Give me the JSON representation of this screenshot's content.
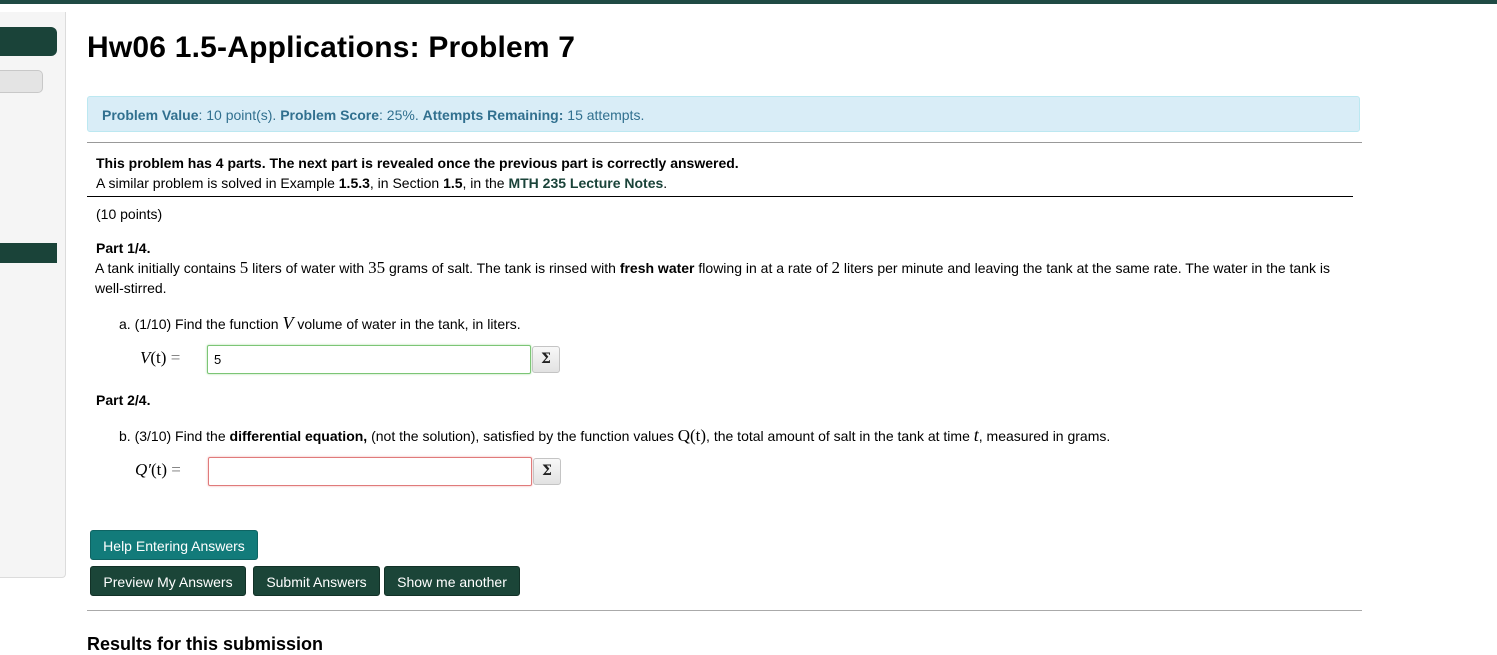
{
  "page_title": "Hw06 1.5-Applications: Problem 7",
  "info": {
    "value_label": "Problem Value",
    "value_text": ": 10 point(s). ",
    "score_label": "Problem Score",
    "score_text": ": 25%. ",
    "attempts_label": "Attempts Remaining:",
    "attempts_text": " 15 attempts."
  },
  "intro": {
    "line1": "This problem has 4 parts. The next part is revealed once the previous part is correctly answered.",
    "line2_a": "A similar problem is solved in Example ",
    "line2_example": "1.5.3",
    "line2_b": ", in Section ",
    "line2_section": "1.5",
    "line2_c": ", in the ",
    "line2_link": "MTH 235 Lecture Notes",
    "line2_d": "."
  },
  "points": "(10 points)",
  "part1": {
    "heading": "Part 1/4.",
    "t1": "A tank initially contains ",
    "n1": "5",
    "t2": " liters of water with ",
    "n2": "35",
    "t3": " grams of salt. The tank is rinsed with ",
    "bold": "fresh water",
    "t4": " flowing in at a rate of ",
    "n3": "2",
    "t5": " liters per minute and leaving the tank at the same rate. The water in the tank is well-stirred.",
    "question_a": "a. (1/10) Find the function ",
    "question_var": "V",
    "question_b": " volume of water in the tank, in liters.",
    "answer_label_var": "V",
    "answer_label_arg": "(t)",
    "answer_label_eq": " =",
    "answer_value": "5"
  },
  "part2": {
    "heading": "Part 2/4.",
    "q_a": "b. (3/10) Find the ",
    "q_bold": "differential equation,",
    "q_b": " (not the solution), satisfied by the function values ",
    "q_var": "Q(t)",
    "q_c": ", the total amount of salt in the tank at time ",
    "q_t": "t",
    "q_d": ", measured in grams.",
    "answer_label_var": "Q′",
    "answer_label_arg": "(t)",
    "answer_label_eq": " =",
    "answer_value": ""
  },
  "sigma_symbol": "Σ",
  "buttons": {
    "help": "Help Entering Answers",
    "preview": "Preview My Answers",
    "submit": "Submit Answers",
    "another": "Show me another"
  },
  "results_heading": "Results for this submission",
  "colors": {
    "top_bar": "#1f4a44",
    "info_bg": "#d9edf7",
    "info_text": "#31708f",
    "btn_teal": "#127b7a",
    "btn_dark": "#1b4538",
    "link": "#1a4339"
  }
}
